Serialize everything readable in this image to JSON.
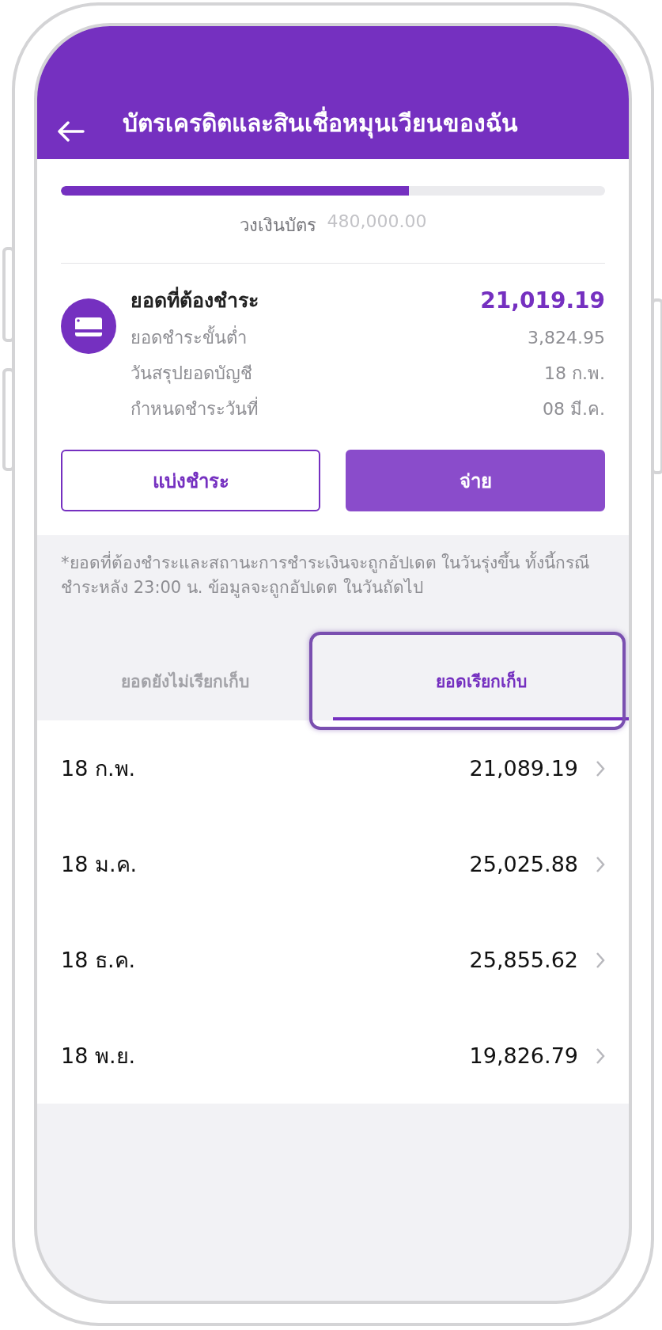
{
  "header": {
    "title": "บัตรเครดิตและสินเชื่อหมุนเวียนของฉัน"
  },
  "usage": {
    "level": 0.64,
    "limit_label": "วงเงินบัตร",
    "limit_value": "480,000.00"
  },
  "payment": {
    "title": "ยอดที่ต้องชำระ",
    "amount": "21,019.19",
    "details": [
      {
        "label": "ยอดชำระขั้นต่ำ",
        "value": "3,824.95"
      },
      {
        "label": "วันสรุปยอดบัญชี",
        "value": "18 ก.พ."
      },
      {
        "label": "กำหนดชำระวันที่",
        "value": "08 มี.ค."
      }
    ]
  },
  "buttons": [
    {
      "label": "แบ่งชำระ",
      "kind": "outline"
    },
    {
      "label": "จ่าย",
      "kind": "filled"
    }
  ],
  "note": "*ยอดที่ต้องชำระและสถานะการชำระเงินจะถูกอัปเดต ในวันรุ่งขึ้น ทั้งนี้กรณีชำระหลัง 23:00 น. ข้อมูลจะถูกอัปเดต ในวันถัดไป",
  "tabs": [
    {
      "label": "ยอดยังไม่เรียกเก็บ",
      "selected": false,
      "highlighted": false
    },
    {
      "label": "ยอดเรียกเก็บ",
      "selected": true,
      "highlighted": true
    }
  ],
  "statements": [
    {
      "date": "18 ก.พ.",
      "amount": "21,089.19"
    },
    {
      "date": "18 ม.ค.",
      "amount": "25,025.88"
    },
    {
      "date": "18 ธ.ค.",
      "amount": "25,855.62"
    },
    {
      "date": "18 พ.ย.",
      "amount": "19,826.79"
    }
  ]
}
